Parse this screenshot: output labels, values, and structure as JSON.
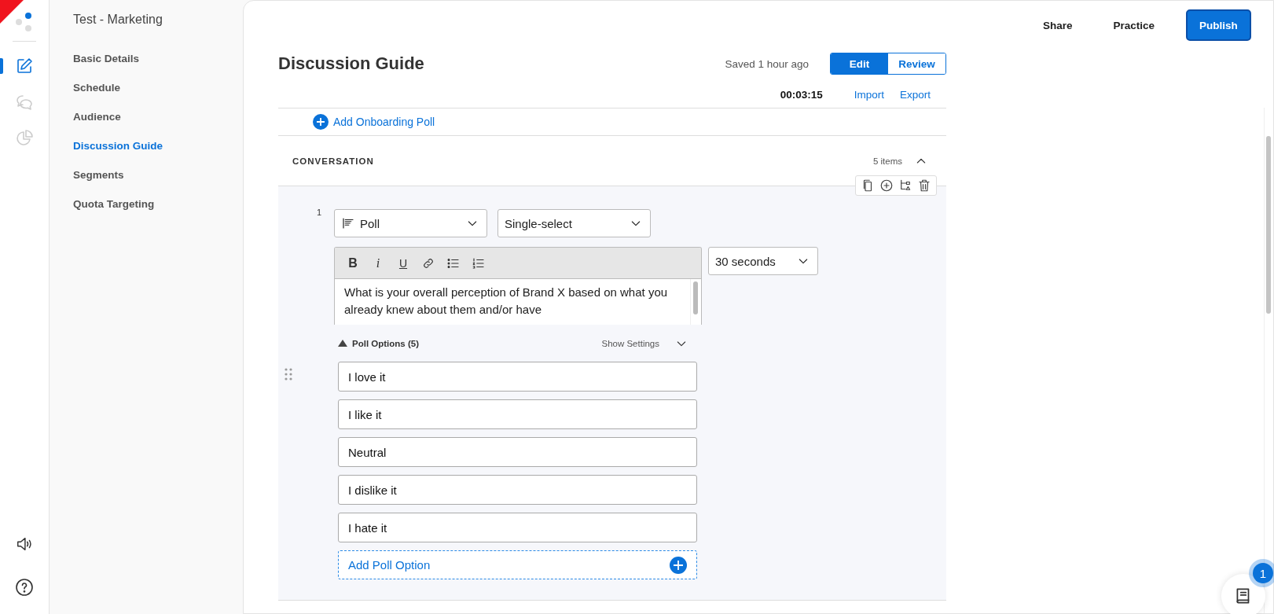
{
  "rail": {
    "items": [
      {
        "kind": "edit",
        "selected": true
      },
      {
        "kind": "chat",
        "selected": false
      },
      {
        "kind": "chart",
        "selected": false
      }
    ]
  },
  "sidebar": {
    "title": "Test - Marketing",
    "items": [
      {
        "label": "Basic Details",
        "selected": false
      },
      {
        "label": "Schedule",
        "selected": false
      },
      {
        "label": "Audience",
        "selected": false
      },
      {
        "label": "Discussion Guide",
        "selected": true
      },
      {
        "label": "Segments",
        "selected": false
      },
      {
        "label": "Quota Targeting",
        "selected": false
      }
    ]
  },
  "header": {
    "actions": [
      "Share",
      "Practice"
    ],
    "publish": "Publish"
  },
  "page": {
    "title": "Discussion Guide",
    "saved": "Saved 1 hour ago",
    "modes": [
      {
        "label": "Edit",
        "selected": true
      },
      {
        "label": "Review",
        "selected": false
      }
    ],
    "timer": "00:03:15",
    "links": [
      "Import",
      "Export"
    ]
  },
  "onboarding": {
    "label": "Add Onboarding Poll"
  },
  "section": {
    "title": "CONVERSATION",
    "count": "5 items",
    "expanded": true
  },
  "question": {
    "number": "1",
    "type": "Poll",
    "mode": "Single-select",
    "duration": "30 seconds",
    "format_buttons": [
      "B",
      "i",
      "U"
    ],
    "text": "What is your overall perception of Brand X based on what you already knew about them and/or have",
    "options_title": "Poll Options (5)",
    "options_expanded": true,
    "settings_label": "Show Settings",
    "options": [
      "I love it",
      "I like it",
      "Neutral",
      "I dislike it",
      "I hate it"
    ],
    "add_label": "Add Poll Option"
  },
  "help_badge": "1"
}
